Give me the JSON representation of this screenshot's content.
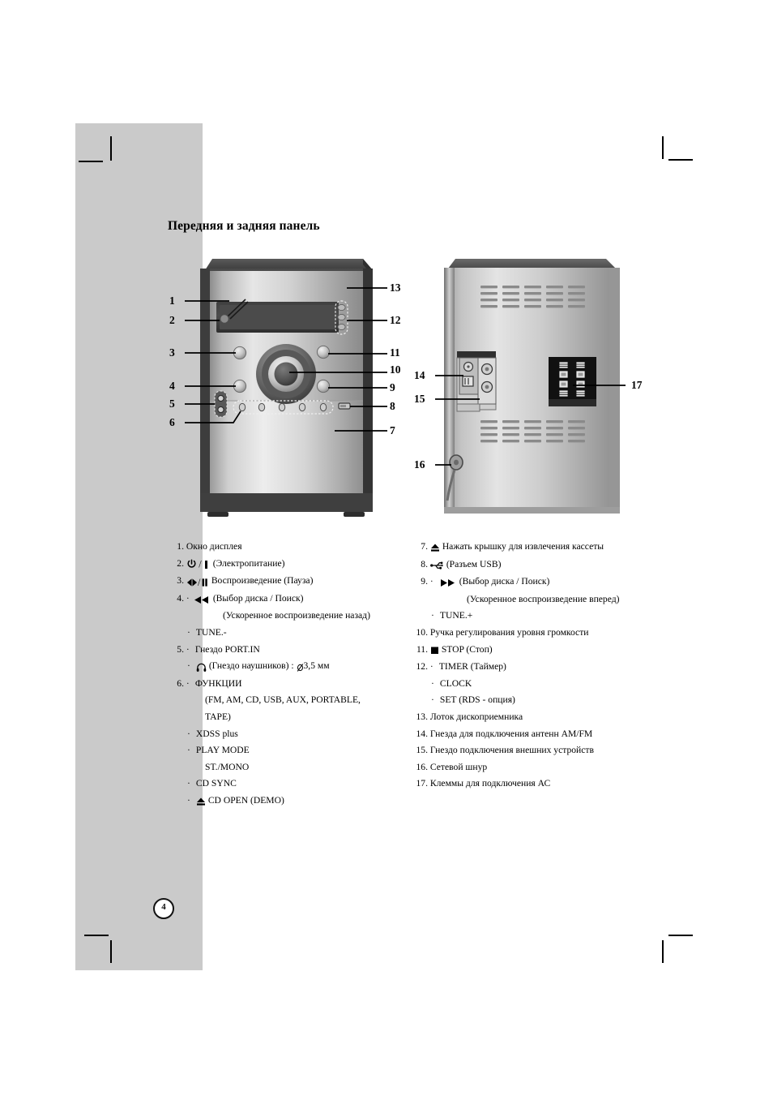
{
  "page": {
    "heading": "Передняя и задняя панель",
    "number": "4",
    "band_color": "#cacaca"
  },
  "front_panel": {
    "callouts": [
      "1",
      "2",
      "3",
      "4",
      "5",
      "6",
      "7",
      "8",
      "9",
      "10",
      "11",
      "12",
      "13"
    ],
    "parts": [
      "display-window",
      "power-button",
      "play-pause-button",
      "skip-back-button",
      "port-in-jack",
      "function-buttons",
      "cassette-door",
      "usb-port",
      "skip-forward-button",
      "volume-knob",
      "stop-button",
      "timer-buttons",
      "disc-tray"
    ]
  },
  "rear_panel": {
    "callouts": [
      "14",
      "15",
      "16",
      "17"
    ],
    "parts": [
      "antenna-terminals",
      "aux-input-jacks",
      "power-cord",
      "speaker-terminals"
    ]
  },
  "left_list": [
    {
      "num": "1.",
      "text": "Окно дисплея",
      "icon": ""
    },
    {
      "num": "2.",
      "text": "(Электропитание)",
      "icon": "power"
    },
    {
      "num": "3.",
      "text": "Воспроизведение (Пауза)",
      "icon": "play-pause"
    },
    {
      "num": "4.",
      "text": "(Выбор диска / Поиск)",
      "icon": "rewind",
      "bullet": true
    },
    {
      "num": "",
      "text": "(Ускоренное воспроизведение назад)",
      "indent": 3
    },
    {
      "num": "",
      "text": "TUNE.-",
      "indent": 1,
      "bullet": true
    },
    {
      "num": "5.",
      "text": "Гнездо PORT.IN",
      "bullet": true
    },
    {
      "num": "",
      "text": "(Гнездо наушников) :",
      "suffix": "3,5 мм",
      "icon": "headphone",
      "indent": 1,
      "bullet": true,
      "diameter": true
    },
    {
      "num": "6.",
      "text": "ФУНКЦИИ",
      "bullet": true
    },
    {
      "num": "",
      "text": "(FM, AM, CD, USB, AUX, PORTABLE,",
      "indent": 2
    },
    {
      "num": "",
      "text": "TAPE)",
      "indent": 2
    },
    {
      "num": "",
      "text": "XDSS plus",
      "indent": 1,
      "bullet": true
    },
    {
      "num": "",
      "text": "PLAY MODE",
      "indent": 1,
      "bullet": true
    },
    {
      "num": "",
      "text": "ST./MONO",
      "indent": 2
    },
    {
      "num": "",
      "text": "CD SYNC",
      "indent": 1,
      "bullet": true
    },
    {
      "num": "",
      "text": "CD OPEN (DEMO)",
      "indent": 1,
      "bullet": true,
      "icon": "eject"
    }
  ],
  "right_list": [
    {
      "num": "7.",
      "text": "Нажать крышку для извлечения кассеты",
      "icon": "eject"
    },
    {
      "num": "8.",
      "text": "(Разъем USB)",
      "icon": "usb"
    },
    {
      "num": "9.",
      "text": "(Выбор диска / Поиск)",
      "icon": "forward",
      "bullet": true
    },
    {
      "num": "",
      "text": "(Ускоренное воспроизведение вперед)",
      "indent": 3
    },
    {
      "num": "",
      "text": "TUNE.+",
      "indent": 1,
      "bullet": true
    },
    {
      "num": "10.",
      "text": "Ручка регулирования уровня громкости"
    },
    {
      "num": "11.",
      "text": "STOP (Стоп)",
      "icon": "stop"
    },
    {
      "num": "12.",
      "text": "TIMER (Таймер)",
      "bullet": true
    },
    {
      "num": "",
      "text": "CLOCK",
      "indent": 1,
      "bullet": true
    },
    {
      "num": "",
      "text": "SET (RDS - опция)",
      "indent": 1,
      "bullet": true
    },
    {
      "num": "13.",
      "text": "Лоток дископриемника"
    },
    {
      "num": "14.",
      "text": "Гнезда для подключения антенн AM/FM"
    },
    {
      "num": "15.",
      "text": "Гнездо подключения внешних устройств"
    },
    {
      "num": "16.",
      "text": "Сетевой шнур"
    },
    {
      "num": "17.",
      "text": "Клеммы для подключения АС"
    }
  ]
}
